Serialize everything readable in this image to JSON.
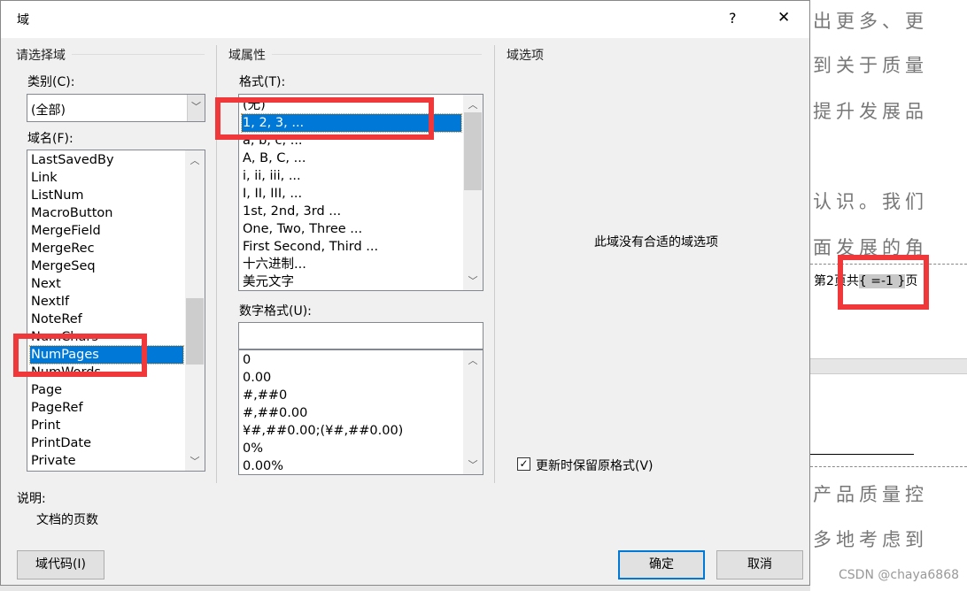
{
  "dialog": {
    "title": "域",
    "help": "?",
    "close": "✕"
  },
  "left": {
    "section": "请选择域",
    "category_label": "类别(C):",
    "category_value": "(全部)",
    "fieldname_label": "域名(F):",
    "fields": [
      "LastSavedBy",
      "Link",
      "ListNum",
      "MacroButton",
      "MergeField",
      "MergeRec",
      "MergeSeq",
      "Next",
      "NextIf",
      "NoteRef",
      "NumChars",
      "NumPages",
      "NumWords",
      "Page",
      "PageRef",
      "Print",
      "PrintDate",
      "Private"
    ],
    "selected_field": "NumPages"
  },
  "middle": {
    "section": "域属性",
    "format_label": "格式(T):",
    "formats": [
      "(无)",
      "1, 2, 3, ...",
      "a, b, c, ...",
      "A, B, C, ...",
      "i, ii, iii, ...",
      "I, II, III, ...",
      "1st, 2nd, 3rd ...",
      "One, Two, Three ...",
      "First Second, Third ...",
      "十六进制...",
      "美元文字"
    ],
    "selected_format": "1, 2, 3, ...",
    "numformat_label": "数字格式(U):",
    "numformat_value": "",
    "numformats": [
      "0",
      "0.00",
      "#,##0",
      "#,##0.00",
      "¥#,##0.00;(¥#,##0.00)",
      "0%",
      "0.00%"
    ]
  },
  "right": {
    "section": "域选项",
    "no_options": "此域没有合适的域选项",
    "preserve_label": "更新时保留原格式(V)",
    "preserve_checked": true
  },
  "description": {
    "label": "说明:",
    "text": "文档的页数"
  },
  "buttons": {
    "field_codes": "域代码(I)",
    "ok": "确定",
    "cancel": "取消"
  },
  "document": {
    "lines": [
      "出更多、更",
      "到关于质量",
      "提升发展品",
      "认识。我们",
      "面发展的角",
      "产品质量控",
      "多地考虑到"
    ],
    "footer_prefix": "第2页共",
    "field_code": "{ =-1 }",
    "footer_suffix": "页",
    "watermark": "CSDN @chaya6868"
  },
  "colors": {
    "selection": "#0078d7",
    "annotation": "#f0373a"
  }
}
